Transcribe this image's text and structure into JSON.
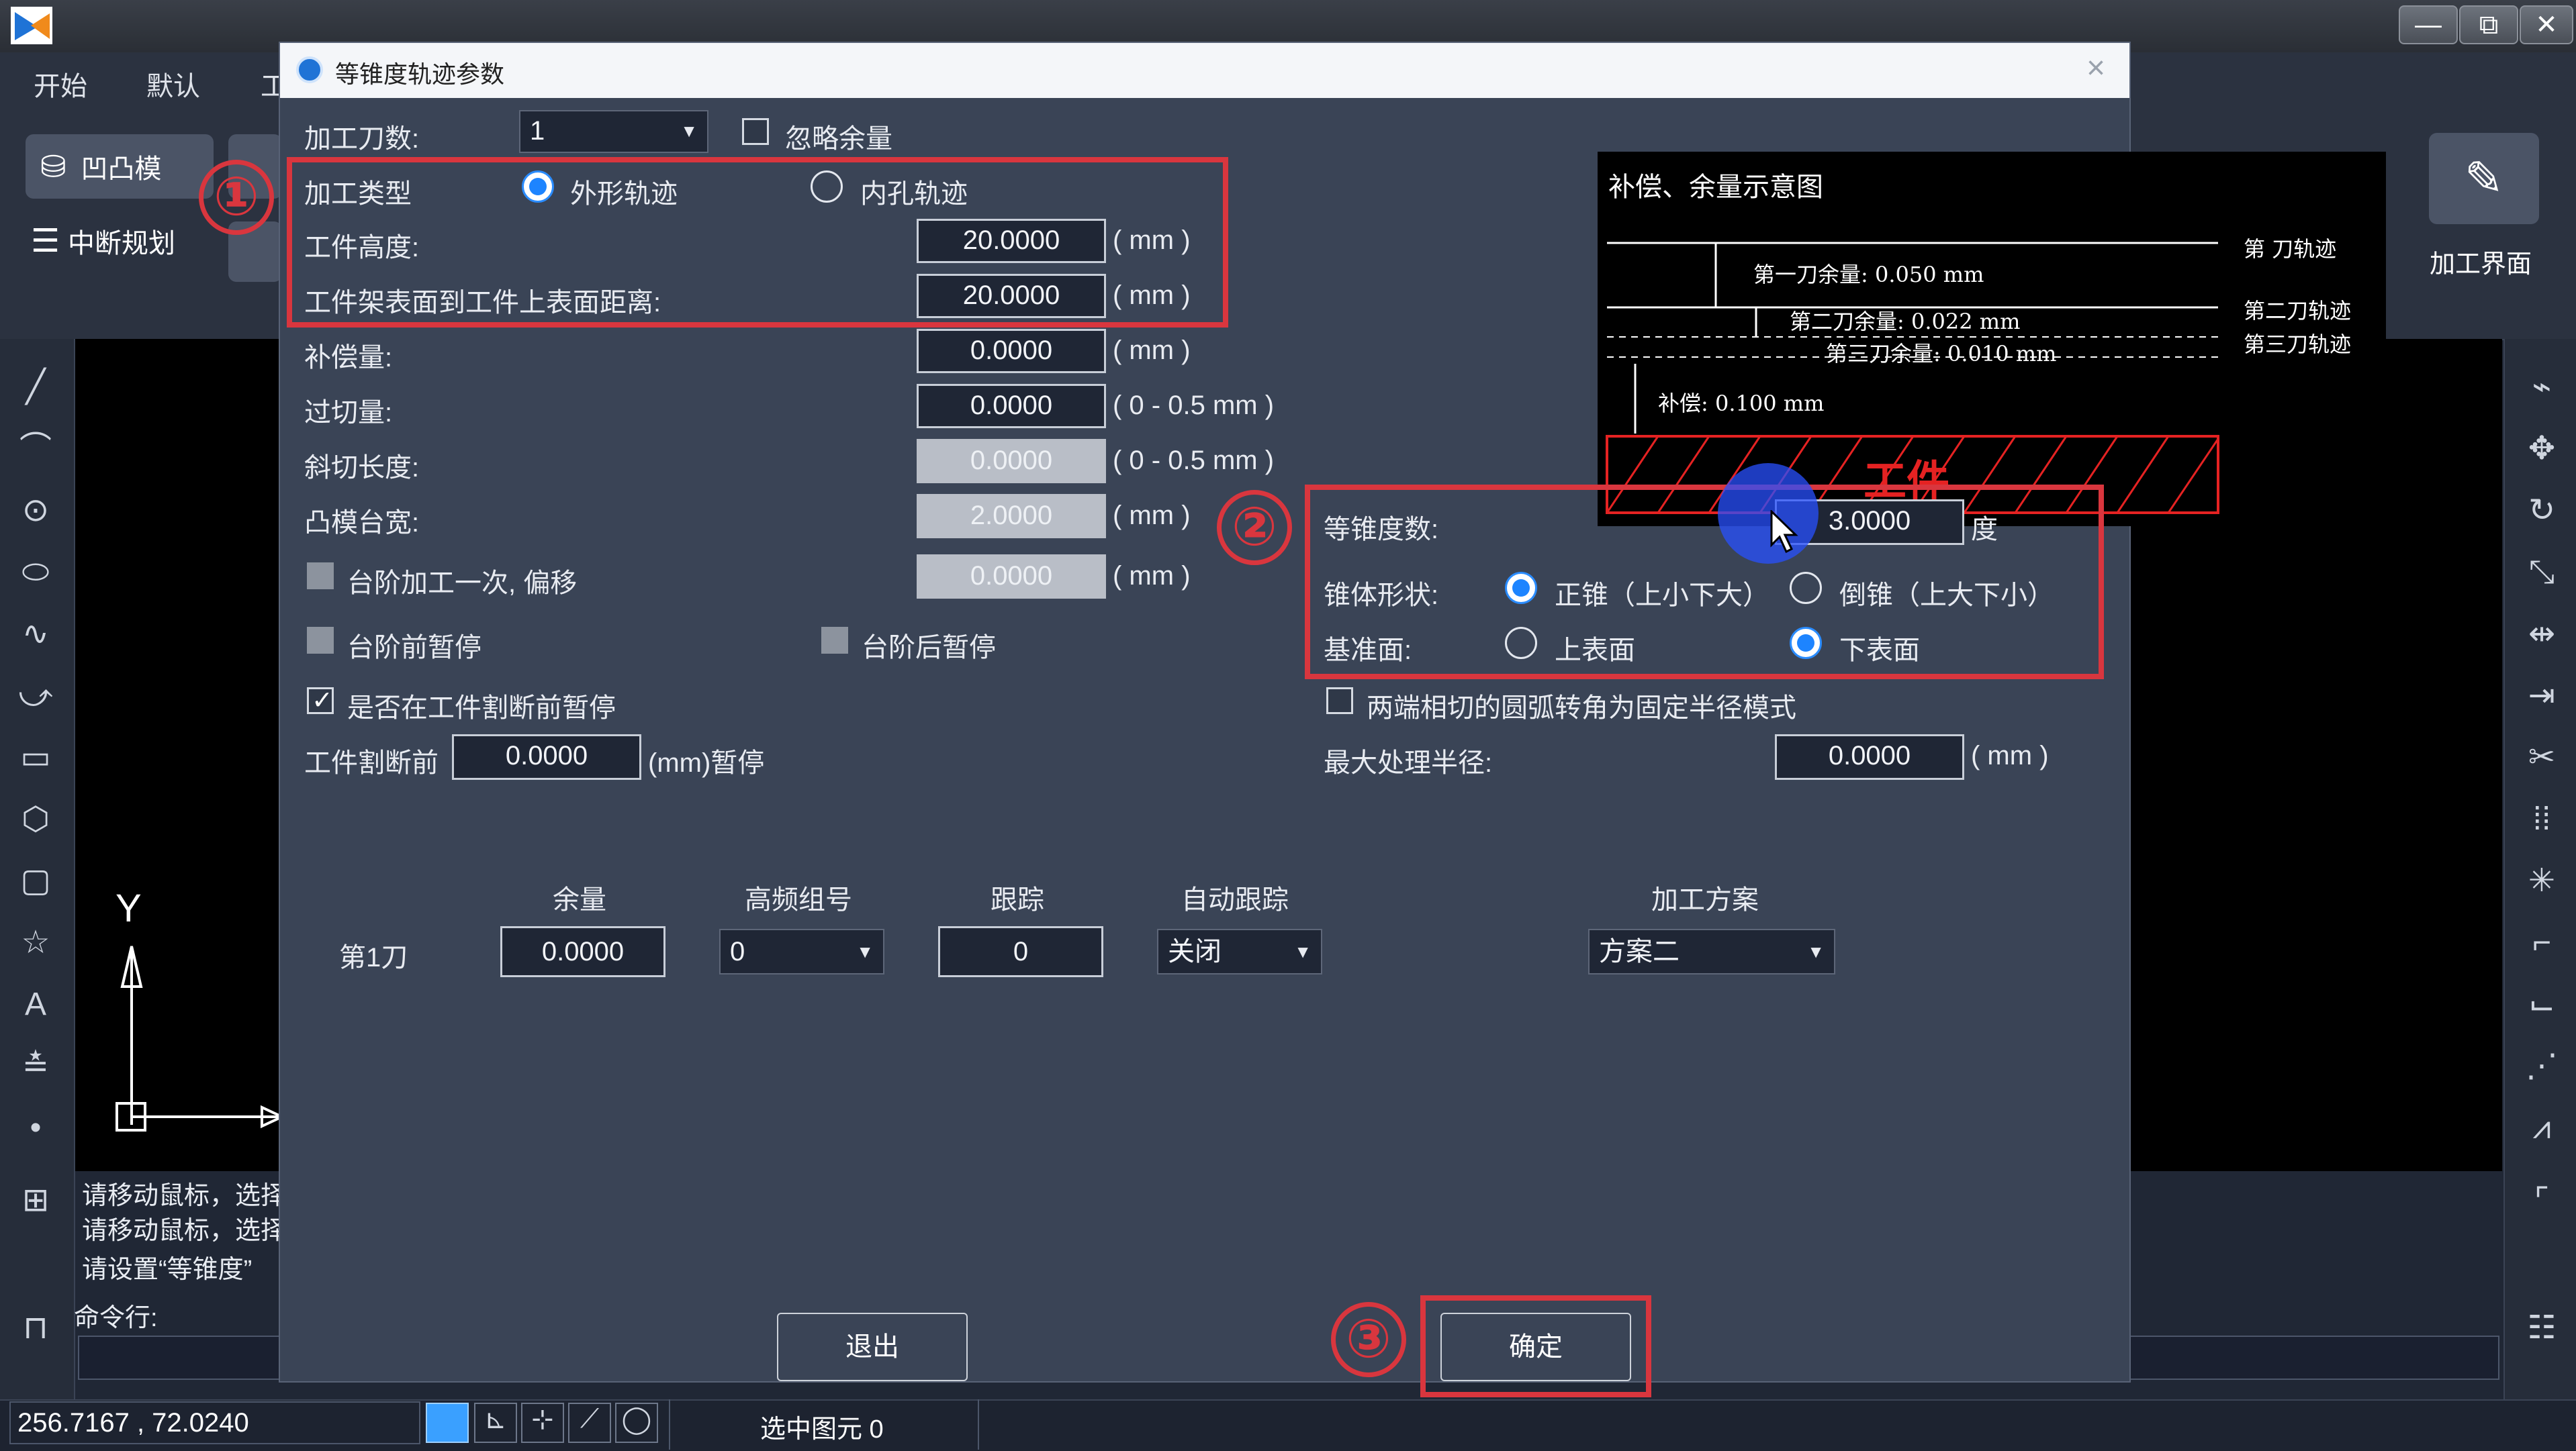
{
  "menubar": {
    "items": [
      "开始",
      "默认",
      "工"
    ]
  },
  "ribbon": {
    "convex_mold": "凹凸模",
    "interrupt_plan": "中断规划",
    "process_interface": "加工界面"
  },
  "axis": {
    "y_label": "Y"
  },
  "console": {
    "lines": [
      "请移动鼠标，选择",
      "请移动鼠标，选择",
      "请设置“等锥度”"
    ],
    "command_label": "命令行:"
  },
  "statusbar": {
    "coords": "256.7167 , 72.0240",
    "selected": "选中图元  0"
  },
  "dialog": {
    "title": "等锥度轨迹参数",
    "cut_count_label": "加工刀数:",
    "cut_count_value": "1",
    "ignore_allowance": "忽略余量",
    "process_type_label": "加工类型",
    "outer_path": "外形轨迹",
    "inner_path": "内孔轨迹",
    "workpiece_height_label": "工件高度:",
    "workpiece_height": "20.0000",
    "frame_distance_label": "工件架表面到工件上表面距离:",
    "frame_distance": "20.0000",
    "compensation_label": "补偿量:",
    "compensation": "0.0000",
    "overcut_label": "过切量:",
    "overcut": "0.0000",
    "bevel_label": "斜切长度:",
    "bevel": "0.0000",
    "die_width_label": "凸模台宽:",
    "die_width": "2.0000",
    "step_once_label": "台阶加工一次, 偏移",
    "step_once": "0.0000",
    "pause_before_step": "台阶前暂停",
    "pause_after_step": "台阶后暂停",
    "pause_before_cut": "是否在工件割断前暂停",
    "cut_before_label": "工件割断前",
    "cut_before_value": "0.0000",
    "cut_before_suffix": "(mm)暂停",
    "unit_mm": "( mm )",
    "unit_range": "( 0 - 0.5 mm )",
    "taper_label": "等锥度数:",
    "taper_value": "3.0000",
    "taper_unit": "度",
    "cone_shape_label": "锥体形状:",
    "cone_positive": "正锥（上小下大）",
    "cone_negative": "倒锥（上大下小）",
    "base_label": "基准面:",
    "base_top": "上表面",
    "base_bottom": "下表面",
    "arc_mode": "两端相切的圆弧转角为固定半径模式",
    "max_radius_label": "最大处理半径:",
    "max_radius": "0.0000",
    "table": {
      "headers": [
        "余量",
        "高频组号",
        "跟踪",
        "自动跟踪",
        "加工方案"
      ],
      "row_label": "第1刀",
      "allowance": "0.0000",
      "hf_group": "0",
      "tracking": "0",
      "auto_tracking": "关闭",
      "scheme": "方案二"
    },
    "exit_button": "退出",
    "ok_button": "确定"
  },
  "diagram": {
    "title": "补偿、余量示意图",
    "cut1_allowance": "第一刀余量:  0.050 mm",
    "cut2_allowance": "第二刀余量:  0.022 mm",
    "cut3_allowance": "第三刀余量:  0.010 mm",
    "compensation": "补偿:  0.100 mm",
    "workpiece": "工件",
    "track1": "第  刀轨迹",
    "track2": "第二刀轨迹",
    "track3": "第三刀轨迹"
  },
  "annotations": {
    "n1": "①",
    "n2": "②",
    "n3": "③"
  },
  "colors": {
    "highlight": "#d9363e",
    "accent": "#1d84ff",
    "dialog_bg": "#3a4456"
  }
}
